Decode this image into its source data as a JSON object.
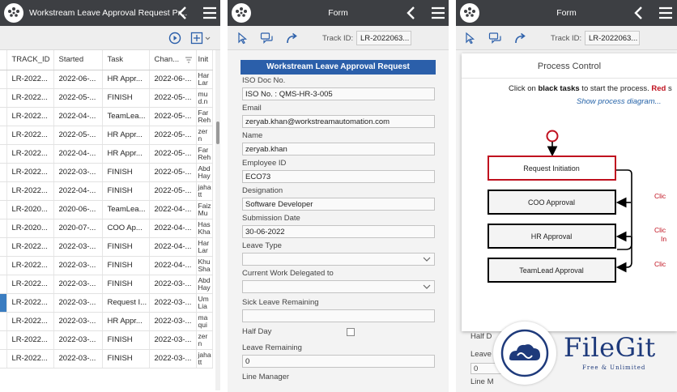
{
  "panel1": {
    "title": "Workstream Leave Approval Request Pr...",
    "columns": [
      "TRACK_ID",
      "Started",
      "Task",
      "Chan...",
      "Init"
    ],
    "rows": [
      {
        "track": "LR-2022...",
        "started": "2022-06-...",
        "task": "HR Appr...",
        "changed": "2022-06-...",
        "init": "Har Lar",
        "selected": false
      },
      {
        "track": "LR-2022...",
        "started": "2022-05-...",
        "task": "FINISH",
        "changed": "2022-05-...",
        "init": "mu d.n",
        "selected": false
      },
      {
        "track": "LR-2022...",
        "started": "2022-04-...",
        "task": "TeamLea...",
        "changed": "2022-05-...",
        "init": "Far Reh",
        "selected": false
      },
      {
        "track": "LR-2022...",
        "started": "2022-05-...",
        "task": "HR Appr...",
        "changed": "2022-05-...",
        "init": "zer n",
        "selected": false
      },
      {
        "track": "LR-2022...",
        "started": "2022-04-...",
        "task": "HR Appr...",
        "changed": "2022-05-...",
        "init": "Far Reh",
        "selected": false
      },
      {
        "track": "LR-2022...",
        "started": "2022-03-...",
        "task": "FINISH",
        "changed": "2022-05-...",
        "init": "Abd Hay",
        "selected": false
      },
      {
        "track": "LR-2022...",
        "started": "2022-04-...",
        "task": "FINISH",
        "changed": "2022-05-...",
        "init": "jaha tt",
        "selected": false
      },
      {
        "track": "LR-2020...",
        "started": "2020-06-...",
        "task": "TeamLea...",
        "changed": "2022-04-...",
        "init": "Faiz Mu",
        "selected": false
      },
      {
        "track": "LR-2020...",
        "started": "2020-07-...",
        "task": "COO Ap...",
        "changed": "2022-04-...",
        "init": "Has Kha",
        "selected": false
      },
      {
        "track": "LR-2022...",
        "started": "2022-03-...",
        "task": "FINISH",
        "changed": "2022-04-...",
        "init": "Har Lar",
        "selected": false
      },
      {
        "track": "LR-2022...",
        "started": "2022-03-...",
        "task": "FINISH",
        "changed": "2022-04-...",
        "init": "Khu Sha",
        "selected": false
      },
      {
        "track": "LR-2022...",
        "started": "2022-03-...",
        "task": "FINISH",
        "changed": "2022-03-...",
        "init": "Abd Hay",
        "selected": false
      },
      {
        "track": "LR-2022...",
        "started": "2022-03-...",
        "task": "Request I...",
        "changed": "2022-03-...",
        "init": "Um Lia",
        "selected": true
      },
      {
        "track": "LR-2022...",
        "started": "2022-03-...",
        "task": "HR Appr...",
        "changed": "2022-03-...",
        "init": "ma qui",
        "selected": false
      },
      {
        "track": "LR-2022...",
        "started": "2022-03-...",
        "task": "FINISH",
        "changed": "2022-03-...",
        "init": "zer n",
        "selected": false
      },
      {
        "track": "LR-2022...",
        "started": "2022-03-...",
        "task": "FINISH",
        "changed": "2022-03-...",
        "init": "jaha tt",
        "selected": false
      }
    ]
  },
  "panel2": {
    "title": "Form",
    "track_label": "Track ID:",
    "track_value": "LR-2022063...",
    "header": "Workstream Leave Approval Request",
    "fields": {
      "iso_label": "ISO Doc No.",
      "iso_value": "ISO No. : QMS-HR-3-005",
      "email_label": "Email",
      "email_value": "zeryab.khan@workstreamautomation.com",
      "name_label": "Name",
      "name_value": "zeryab.khan",
      "empid_label": "Employee ID",
      "empid_value": "ECO73",
      "desig_label": "Designation",
      "desig_value": "Software Developer",
      "subdate_label": "Submission Date",
      "subdate_value": "30-06-2022",
      "leavetype_label": "Leave Type",
      "leavetype_value": "",
      "delegated_label": "Current Work Delegated to",
      "delegated_value": "",
      "sick_label": "Sick Leave Remaining",
      "sick_value": "",
      "halfday_label": "Half Day",
      "leaverem_label": "Leave Remaining",
      "leaverem_value": "0",
      "linemgr_label": "Line Manager"
    }
  },
  "panel3": {
    "title": "Form",
    "track_label": "Track ID:",
    "track_value": "LR-2022063...",
    "popup_title": "Process Control",
    "instr_pre": "Click on ",
    "instr_bold": "black tasks",
    "instr_mid": " to start the process. ",
    "instr_red": "Red",
    "instr_post": " s",
    "show_link": "Show process diagram...",
    "steps": [
      "Request Initiation",
      "COO Approval",
      "HR Approval",
      "TeamLead Approval"
    ],
    "click_hints": [
      "Clic",
      "Clic",
      "In",
      "Clic"
    ],
    "ghost_half_day": "Half D",
    "ghost_leave": "Leave",
    "ghost_zero": "0",
    "ghost_line": "Line M"
  },
  "watermark": {
    "brand": "FileGit",
    "tagline": "Free & Unlimited"
  },
  "colors": {
    "topbar": "#3d3f43",
    "form_header": "#2b5faa",
    "selected_row": "#3b7dc1",
    "active_step_border": "#c0111f",
    "link": "#2563a8"
  },
  "icons": [
    "logo-icon",
    "chevron-left-icon",
    "hamburger-menu-icon",
    "play-icon",
    "add-column-icon",
    "cursor-icon",
    "comments-icon",
    "forward-icon",
    "caret-down-icon",
    "sort-icon"
  ]
}
